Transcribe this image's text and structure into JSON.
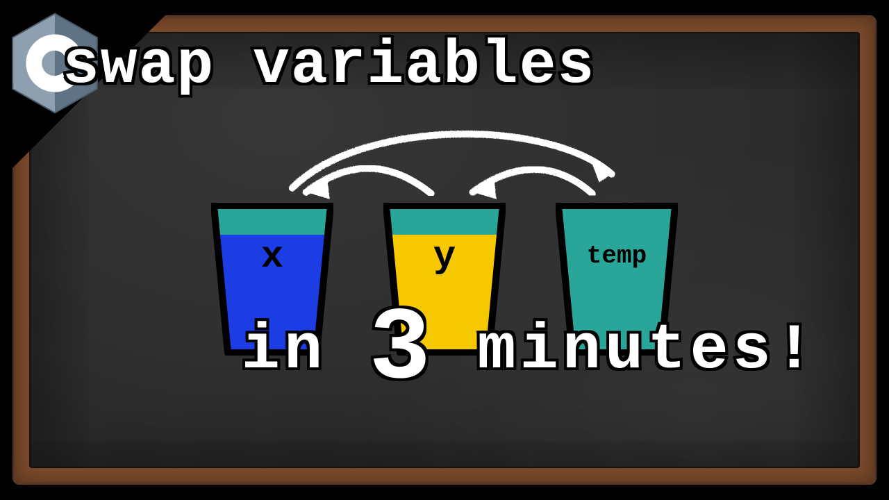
{
  "headline": "swap variables",
  "footline_prefix": "in ",
  "footline_number": "3",
  "footline_suffix": " minutes!",
  "cups": {
    "x": {
      "label": "x"
    },
    "y": {
      "label": "y"
    },
    "temp": {
      "label": "temp"
    }
  },
  "colors": {
    "cup_rim": "#2aa59a",
    "cup_stroke": "#000000",
    "x_fill": "#1b3de3",
    "y_fill": "#f5c800",
    "temp_fill": "#2aa59a",
    "arrow": "#ffffff"
  }
}
